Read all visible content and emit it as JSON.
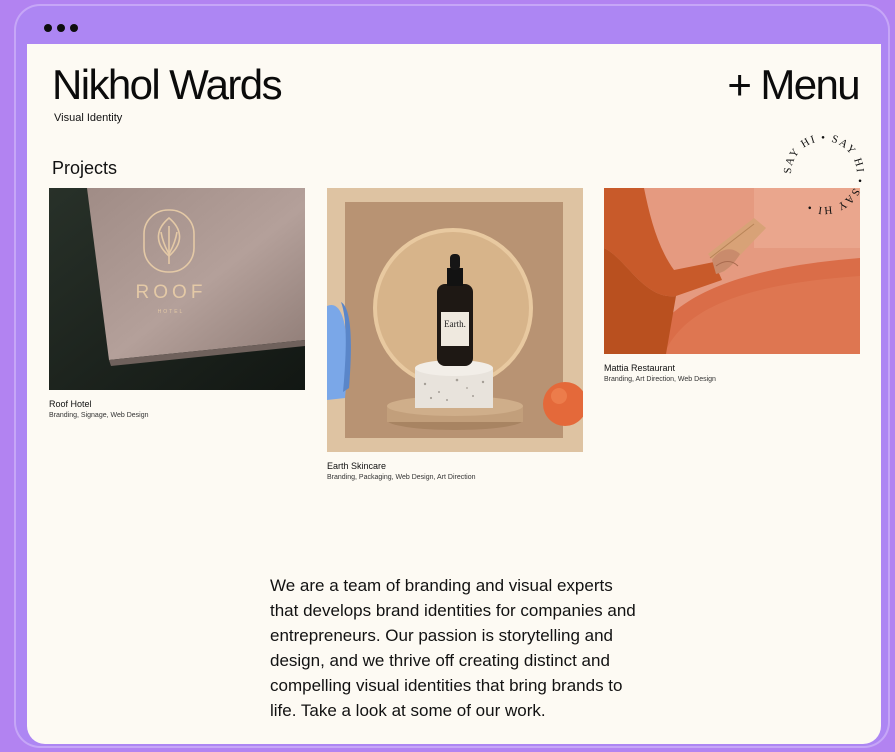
{
  "window": {
    "controls": [
      "close",
      "minimize",
      "maximize"
    ]
  },
  "header": {
    "title": "Nikhol Wards",
    "subtitle": "Visual Identity",
    "menu_label": "+ Menu"
  },
  "projects": {
    "heading": "Projects",
    "items": [
      {
        "name": "Roof Hotel",
        "tags": "Branding, Signage, Web Design",
        "image_text": "ROOF",
        "image_subtext": "HOTEL"
      },
      {
        "name": "Earth Skincare",
        "tags": "Branding, Packaging, Web Design, Art Direction",
        "image_text": "Earth."
      },
      {
        "name": "Mattia Restaurant",
        "tags": "Branding, Art Direction, Web Design"
      }
    ]
  },
  "badge": {
    "text": "SAY HI • SAY HI • SAY HI • "
  },
  "intro": {
    "text": "We are a team of branding and visual experts that develops brand identities for companies and entrepreneurs. Our passion is storytelling and design, and we thrive off creating distinct and compelling visual identities that bring brands to life. Take a look at some of our work."
  },
  "colors": {
    "frame": "#ad86f3",
    "page": "#fdfaf3",
    "accent_orange": "#e4693a"
  }
}
